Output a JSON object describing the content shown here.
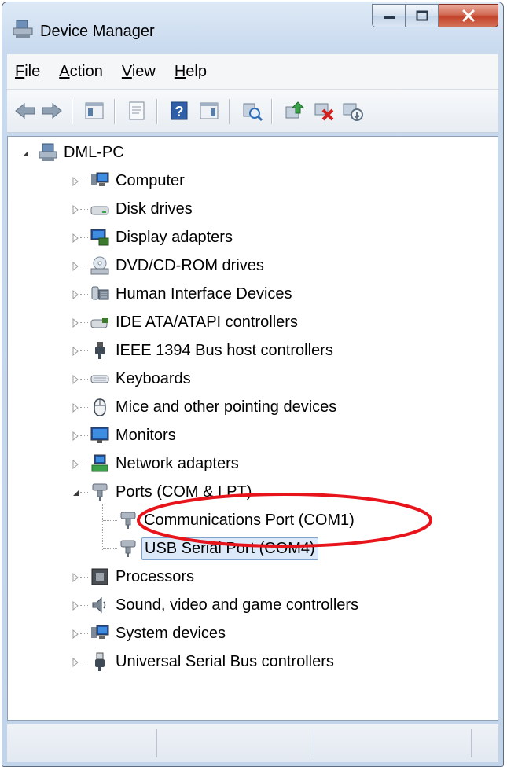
{
  "window": {
    "title": "Device Manager"
  },
  "menu": [
    {
      "label": "File",
      "key": "F",
      "rest": "ile"
    },
    {
      "label": "Action",
      "key": "A",
      "rest": "ction"
    },
    {
      "label": "View",
      "key": "V",
      "rest": "iew"
    },
    {
      "label": "Help",
      "key": "H",
      "rest": "elp"
    }
  ],
  "toolbar": {
    "buttons": [
      "back-icon",
      "forward-icon",
      "show-hide-console-tree-icon",
      "properties-icon",
      "help-icon",
      "show-action-pane-icon",
      "scan-hardware-icon",
      "update-driver-icon",
      "uninstall-icon",
      "disable-device-icon"
    ]
  },
  "tree": {
    "root": "DML-PC",
    "categories": [
      {
        "label": "Computer",
        "icon": "computer-icon"
      },
      {
        "label": "Disk drives",
        "icon": "disk-drive-icon"
      },
      {
        "label": "Display adapters",
        "icon": "display-adapter-icon"
      },
      {
        "label": "DVD/CD-ROM drives",
        "icon": "dvd-drive-icon"
      },
      {
        "label": "Human Interface Devices",
        "icon": "hid-icon"
      },
      {
        "label": "IDE ATA/ATAPI controllers",
        "icon": "ide-controller-icon"
      },
      {
        "label": "IEEE 1394 Bus host controllers",
        "icon": "ieee1394-icon"
      },
      {
        "label": "Keyboards",
        "icon": "keyboard-icon"
      },
      {
        "label": "Mice and other pointing devices",
        "icon": "mouse-icon"
      },
      {
        "label": "Monitors",
        "icon": "monitor-icon"
      },
      {
        "label": "Network adapters",
        "icon": "network-adapter-icon"
      },
      {
        "label": "Ports (COM & LPT)",
        "icon": "port-icon",
        "expanded": true,
        "children": [
          {
            "label": "Communications Port (COM1)",
            "icon": "port-icon"
          },
          {
            "label": "USB Serial Port (COM4)",
            "icon": "port-icon",
            "selected": true
          }
        ]
      },
      {
        "label": "Processors",
        "icon": "processor-icon"
      },
      {
        "label": "Sound, video and game controllers",
        "icon": "sound-icon"
      },
      {
        "label": "System devices",
        "icon": "system-device-icon"
      },
      {
        "label": "Universal Serial Bus controllers",
        "icon": "usb-icon"
      }
    ]
  },
  "annotation": {
    "color": "#e8141c",
    "target": "Communications Port (COM1)"
  },
  "colors": {
    "title_bg": "#c9daef",
    "close_button": "#c4422a",
    "selection": "#dce9f8"
  }
}
